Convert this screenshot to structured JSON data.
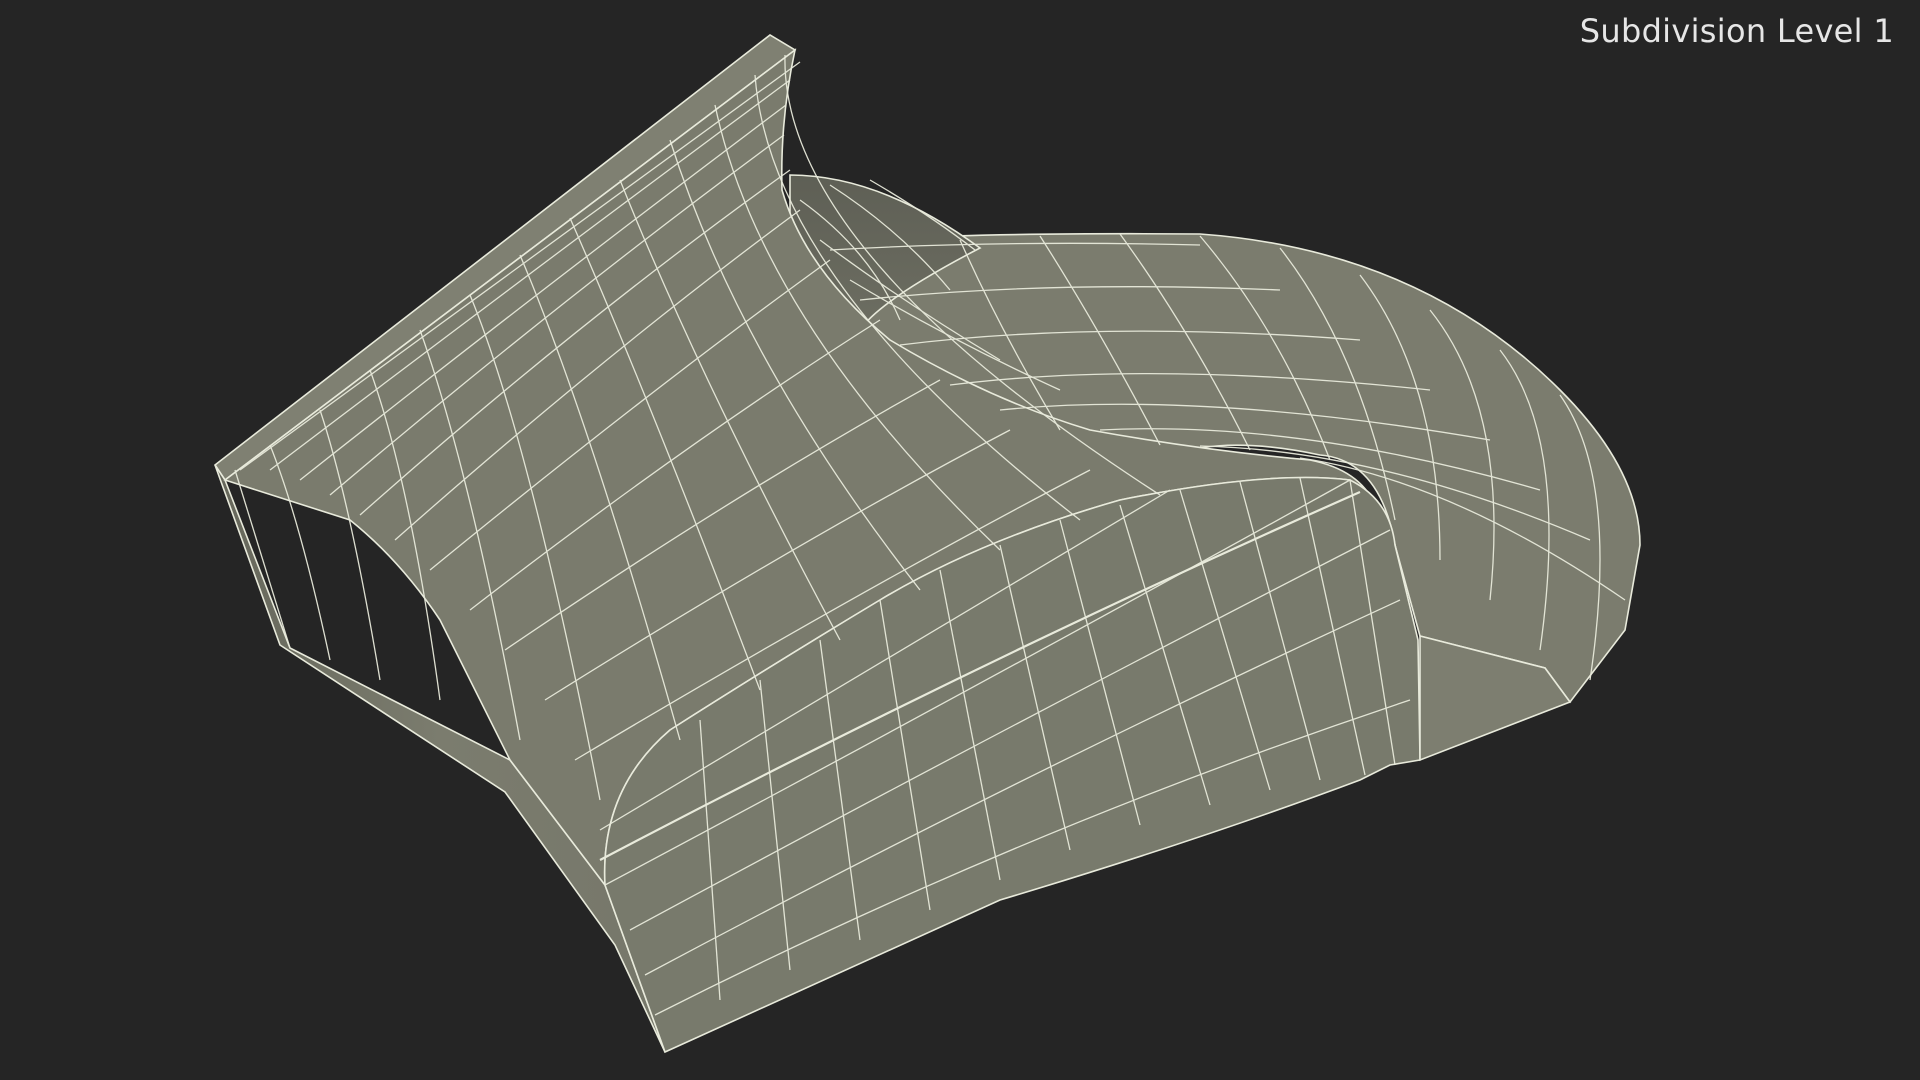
{
  "overlay": {
    "subdivision_label": "Subdivision Level 1"
  },
  "scene": {
    "model": "wireframe-mesh",
    "colors": {
      "background": "#252525",
      "surface": "#7a7b6d",
      "surface_shade": "#66675b",
      "surface_light": "#878878",
      "wire": "#e8eadb"
    }
  }
}
